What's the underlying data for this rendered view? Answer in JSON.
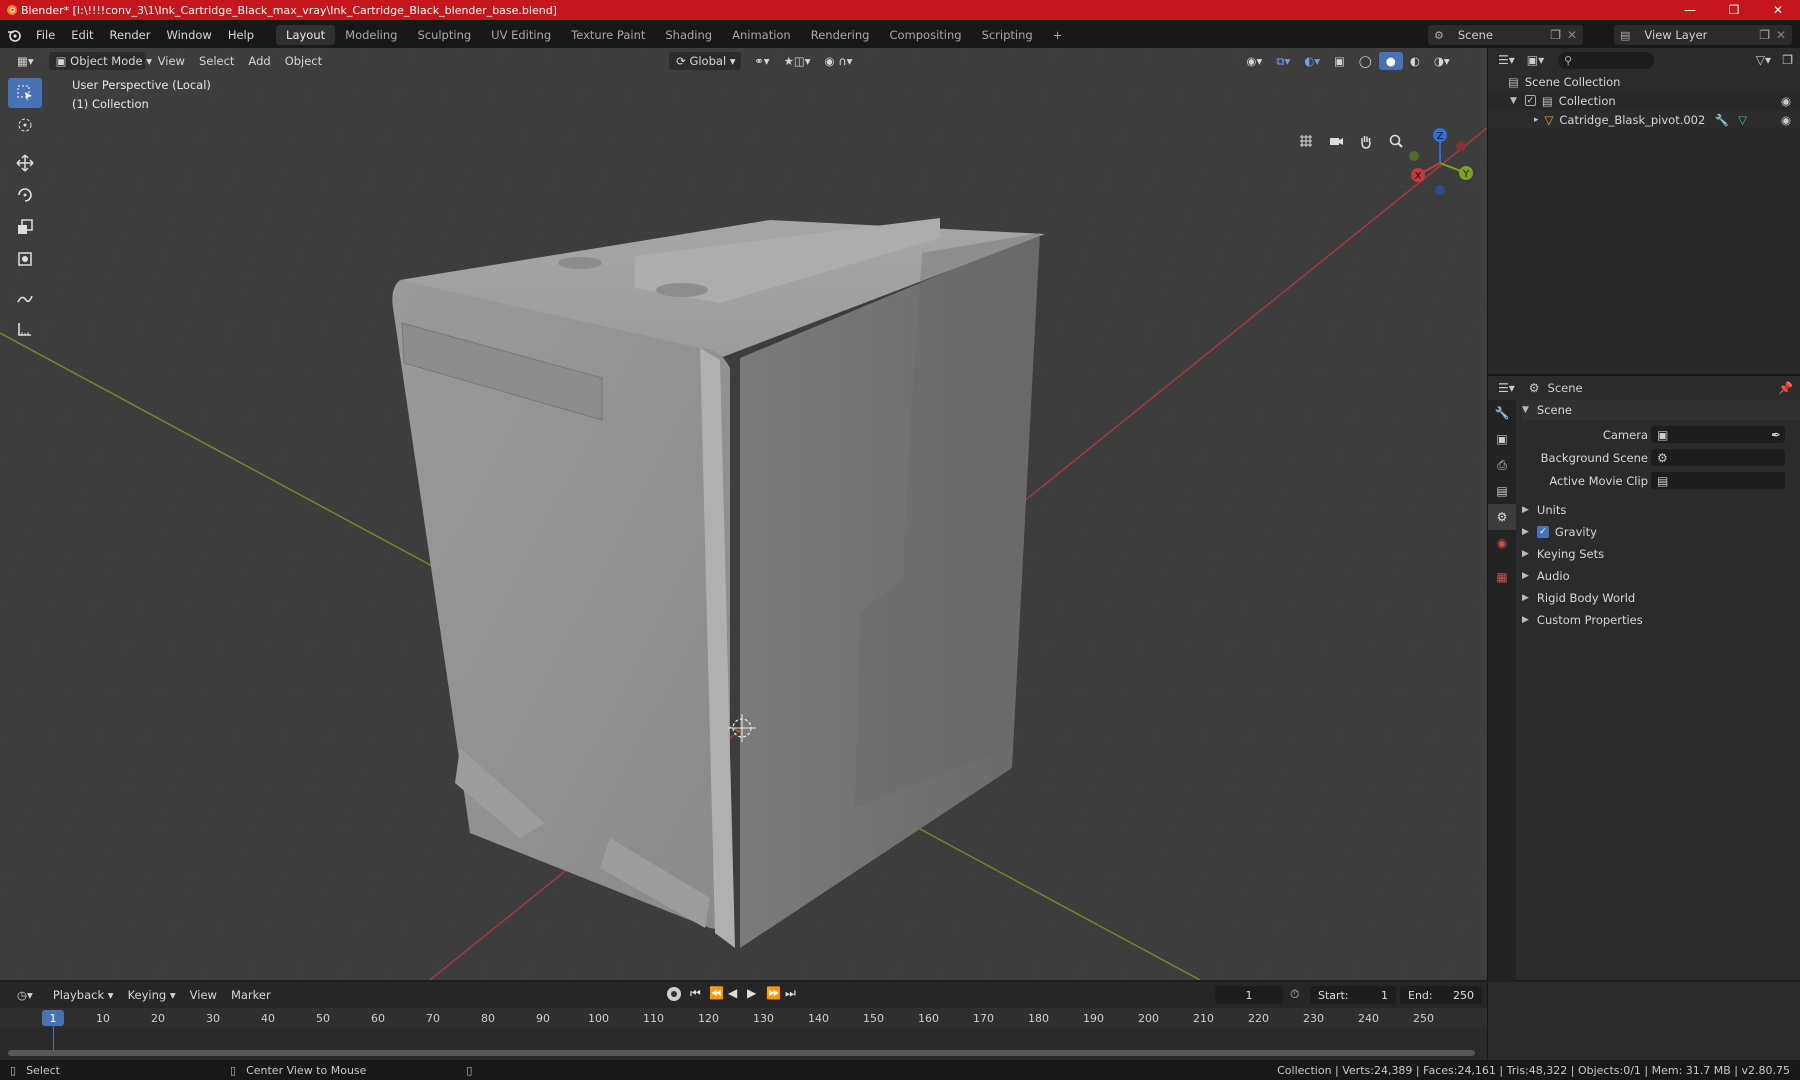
{
  "window": {
    "title": "Blender* [I:\\!!!!conv_3\\1\\Ink_Cartridge_Black_max_vray\\Ink_Cartridge_Black_blender_base.blend]",
    "controls": [
      "minimize-icon",
      "maximize-icon",
      "close-icon"
    ]
  },
  "menubar": {
    "menus": [
      "File",
      "Edit",
      "Render",
      "Window",
      "Help"
    ],
    "workspaces": [
      "Layout",
      "Modeling",
      "Sculpting",
      "UV Editing",
      "Texture Paint",
      "Shading",
      "Animation",
      "Rendering",
      "Compositing",
      "Scripting"
    ],
    "active_workspace": "Layout",
    "scene": "Scene",
    "view_layer": "View Layer"
  },
  "viewport_header": {
    "mode": "Object Mode",
    "menus": [
      "View",
      "Select",
      "Add",
      "Object"
    ],
    "orientation": "Global"
  },
  "viewport": {
    "perspective_label": "User Perspective (Local)",
    "collection_label": "(1) Collection",
    "gizmo": {
      "x": "X",
      "y": "Y",
      "z": "Z"
    },
    "tools": [
      "select-box-icon",
      "cursor-icon",
      "move-icon",
      "rotate-icon",
      "scale-icon",
      "transform-icon",
      "annotate-icon",
      "measure-icon"
    ]
  },
  "outliner": {
    "root": "Scene Collection",
    "collection": "Collection",
    "object": "Catridge_Blask_pivot.002"
  },
  "properties": {
    "header": "Scene",
    "section": "Scene",
    "fields": {
      "camera": "Camera",
      "background_scene": "Background Scene",
      "active_movie_clip": "Active Movie Clip"
    },
    "panels": [
      "Units",
      "Gravity",
      "Keying Sets",
      "Audio",
      "Rigid Body World",
      "Custom Properties"
    ],
    "gravity_checked": true
  },
  "timeline": {
    "menus": [
      "Playback",
      "Keying",
      "View",
      "Marker"
    ],
    "current_frame": "1",
    "start_label": "Start:",
    "start": "1",
    "end_label": "End:",
    "end": "250",
    "ruler": [
      "10",
      "20",
      "30",
      "40",
      "50",
      "60",
      "70",
      "80",
      "90",
      "100",
      "110",
      "120",
      "130",
      "140",
      "150",
      "160",
      "170",
      "180",
      "190",
      "200",
      "210",
      "220",
      "230",
      "240",
      "250"
    ],
    "current_marker": "1"
  },
  "statusbar": {
    "select": "Select",
    "center": "Center View to Mouse",
    "stats": "Collection | Verts:24,389 | Faces:24,161 | Tris:48,322 | Objects:0/1 | Mem: 31.7 MB | v2.80.75"
  },
  "colors": {
    "titlebar": "#c4161c",
    "accent": "#4772b3",
    "x_axis": "#c8383f",
    "y_axis": "#7da21d",
    "z_axis": "#2f72d6"
  }
}
